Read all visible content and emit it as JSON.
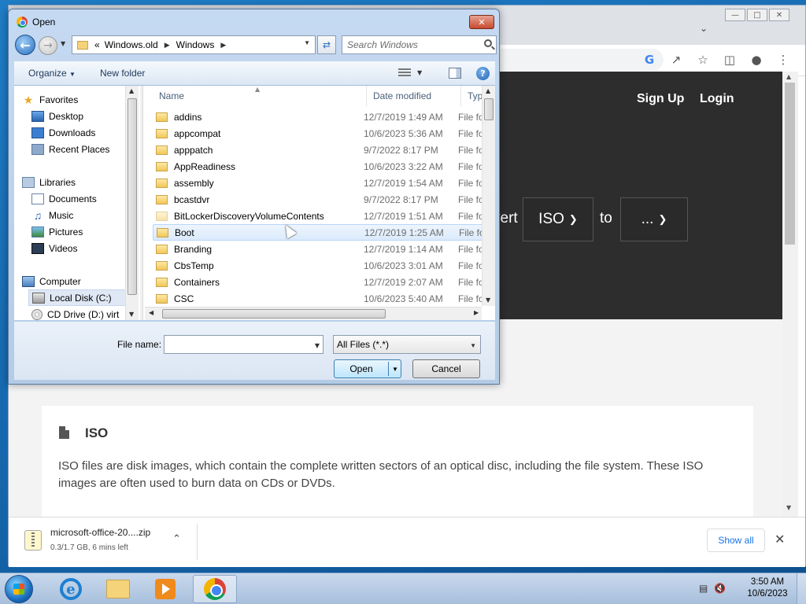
{
  "browser": {
    "nav": {
      "signup": "Sign Up",
      "login": "Login"
    },
    "converter": {
      "partial_text": "vert",
      "from_format": "ISO",
      "to_text": "to",
      "to_format": "..."
    },
    "card": {
      "title": "ISO",
      "description": "ISO files are disk images, which contain the complete written sectors of an optical disc, including the file system. These ISO images are often used to burn data on CDs or DVDs."
    },
    "download": {
      "filename": "microsoft-office-20....zip",
      "status": "0.3/1.7 GB, 6 mins left",
      "show_all": "Show all"
    }
  },
  "dialog": {
    "title": "Open",
    "breadcrumb": [
      "Windows.old",
      "Windows"
    ],
    "search_placeholder": "Search Windows",
    "toolbar": {
      "organize": "Organize",
      "new_folder": "New folder"
    },
    "nav_pane": {
      "favorites": {
        "label": "Favorites",
        "items": [
          "Desktop",
          "Downloads",
          "Recent Places"
        ]
      },
      "libraries": {
        "label": "Libraries",
        "items": [
          "Documents",
          "Music",
          "Pictures",
          "Videos"
        ]
      },
      "computer": {
        "label": "Computer",
        "items": [
          "Local Disk (C:)",
          "CD Drive (D:) virt"
        ]
      }
    },
    "columns": {
      "name": "Name",
      "date": "Date modified",
      "type": "Type"
    },
    "files": [
      {
        "name": "addins",
        "date": "12/7/2019 1:49 AM",
        "type": "File fol"
      },
      {
        "name": "appcompat",
        "date": "10/6/2023 5:36 AM",
        "type": "File fol"
      },
      {
        "name": "apppatch",
        "date": "9/7/2022 8:17 PM",
        "type": "File fol"
      },
      {
        "name": "AppReadiness",
        "date": "10/6/2023 3:22 AM",
        "type": "File fol"
      },
      {
        "name": "assembly",
        "date": "12/7/2019 1:54 AM",
        "type": "File fol"
      },
      {
        "name": "bcastdvr",
        "date": "9/7/2022 8:17 PM",
        "type": "File fol"
      },
      {
        "name": "BitLockerDiscoveryVolumeContents",
        "date": "12/7/2019 1:51 AM",
        "type": "File fol"
      },
      {
        "name": "Boot",
        "date": "12/7/2019 1:25 AM",
        "type": "File fol"
      },
      {
        "name": "Branding",
        "date": "12/7/2019 1:14 AM",
        "type": "File fol"
      },
      {
        "name": "CbsTemp",
        "date": "10/6/2023 3:01 AM",
        "type": "File fol"
      },
      {
        "name": "Containers",
        "date": "12/7/2019 2:07 AM",
        "type": "File fol"
      },
      {
        "name": "CSC",
        "date": "10/6/2023 5:40 AM",
        "type": "File fol"
      }
    ],
    "filename_label": "File name:",
    "filename_value": "",
    "filter": "All Files (*.*)",
    "open_button": "Open",
    "cancel_button": "Cancel"
  },
  "taskbar": {
    "time": "3:50 AM",
    "date": "10/6/2023"
  }
}
